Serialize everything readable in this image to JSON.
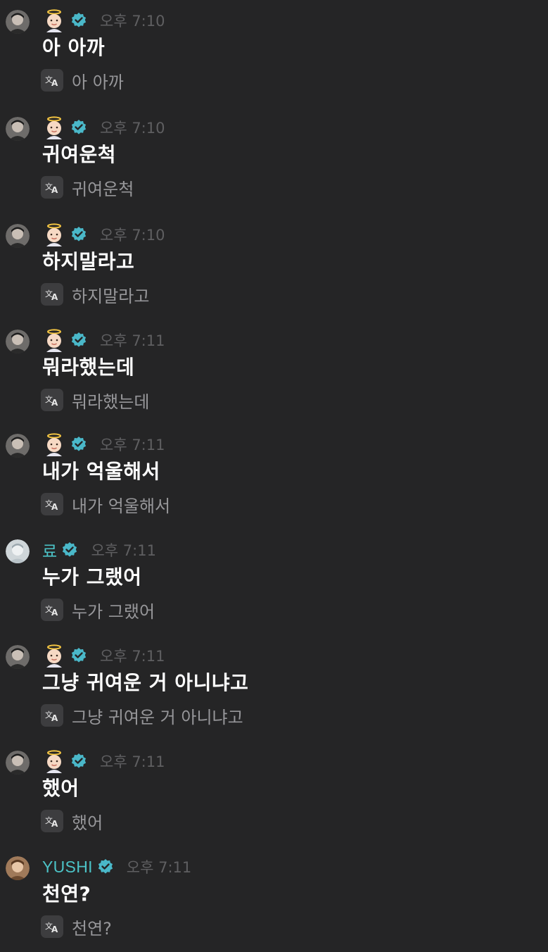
{
  "colors": {
    "background": "#252526",
    "accent_name": "#4cc3c7",
    "verified_badge": "#4ab8c9",
    "timestamp": "#5f5f61",
    "translation_text": "#97979a"
  },
  "messages": [
    {
      "sender_icon": "angel-emoji",
      "sender_name": "",
      "avatar": "member-photo-dark",
      "time": "오후 7:10",
      "text": "아 아까",
      "translation": "아 아까"
    },
    {
      "sender_icon": "angel-emoji",
      "sender_name": "",
      "avatar": "member-photo-dark",
      "time": "오후 7:10",
      "text": "귀여운척",
      "translation": "귀여운척"
    },
    {
      "sender_icon": "angel-emoji",
      "sender_name": "",
      "avatar": "member-photo-dark",
      "time": "오후 7:10",
      "text": "하지말라고",
      "translation": "하지말라고"
    },
    {
      "sender_icon": "angel-emoji",
      "sender_name": "",
      "avatar": "member-photo-dark",
      "time": "오후 7:11",
      "text": "뭐라했는데",
      "translation": "뭐라했는데"
    },
    {
      "sender_icon": "angel-emoji",
      "sender_name": "",
      "avatar": "member-photo-dark",
      "time": "오후 7:11",
      "text": "내가 억울해서",
      "translation": "내가 억울해서"
    },
    {
      "sender_icon": "",
      "sender_name": "료",
      "avatar": "member-photo-light",
      "time": "오후 7:11",
      "text": "누가 그랬어",
      "translation": "누가 그랬어"
    },
    {
      "sender_icon": "angel-emoji",
      "sender_name": "",
      "avatar": "member-photo-dark",
      "time": "오후 7:11",
      "text": "그냥 귀여운 거 아니냐고",
      "translation": "그냥 귀여운 거 아니냐고"
    },
    {
      "sender_icon": "angel-emoji",
      "sender_name": "",
      "avatar": "member-photo-dark",
      "time": "오후 7:11",
      "text": "했어",
      "translation": "했어"
    },
    {
      "sender_icon": "",
      "sender_name": "YUSHI",
      "avatar": "member-photo-warm",
      "time": "오후 7:11",
      "text": "천연?",
      "translation": "천연?"
    }
  ]
}
